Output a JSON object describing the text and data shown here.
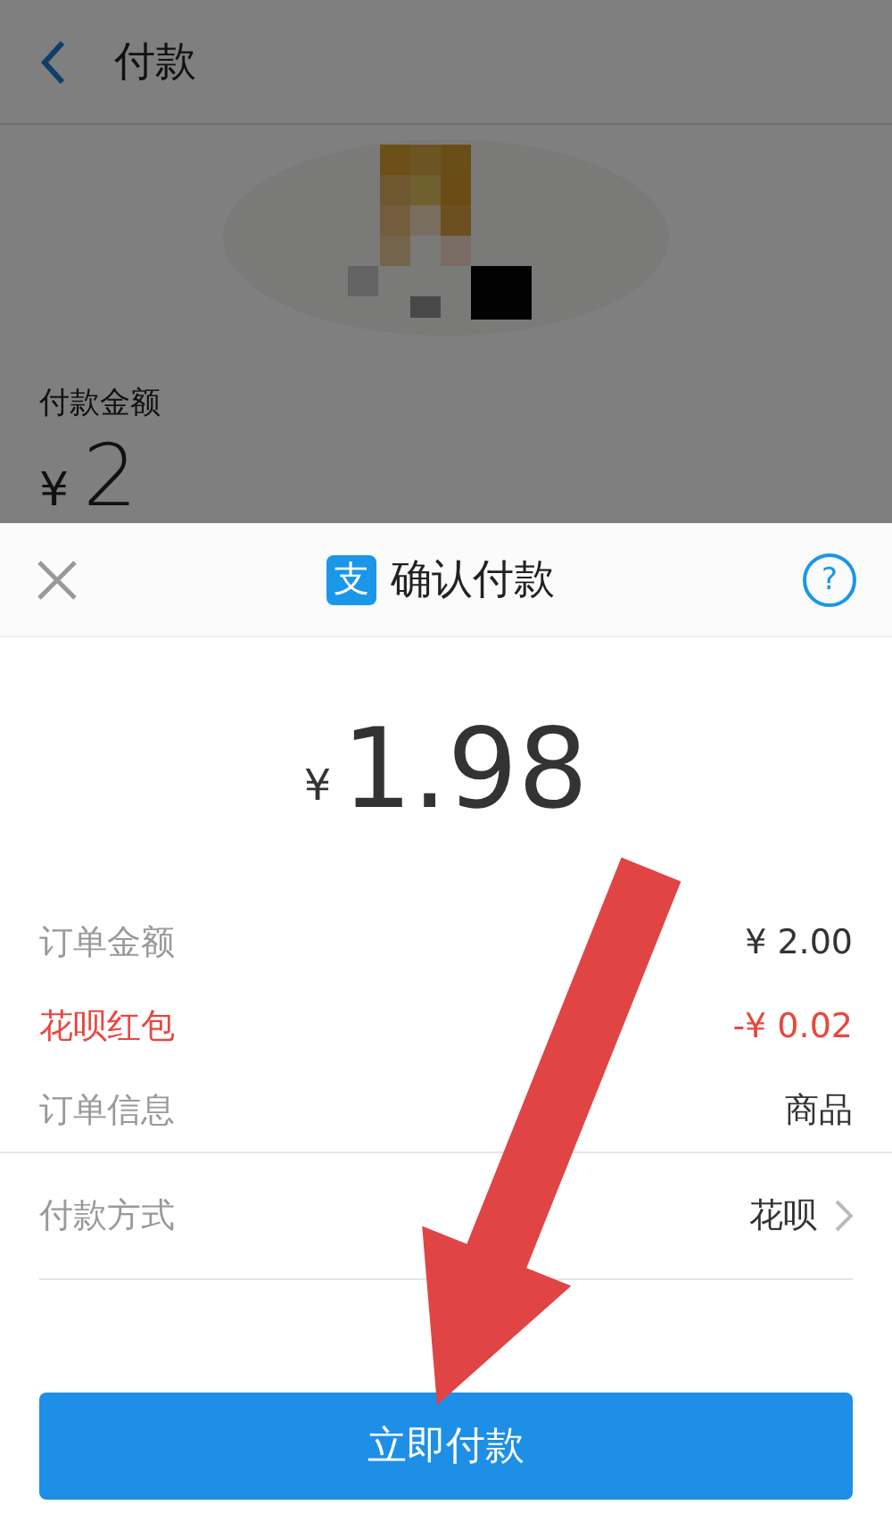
{
  "page": {
    "title": "付款",
    "amount_label": "付款金额",
    "currency": "¥",
    "amount": "2"
  },
  "sheet": {
    "logo": "支",
    "title": "确认付款",
    "help": "?",
    "currency": "¥",
    "total": "1.98",
    "rows": [
      {
        "label": "订单金额",
        "value": "¥ 2.00",
        "kind": "plain"
      },
      {
        "label": "花呗红包",
        "value": "-¥ 0.02",
        "kind": "discount"
      },
      {
        "label": "订单信息",
        "value": "商品",
        "kind": "plain"
      }
    ],
    "payment": {
      "label": "付款方式",
      "value": "花呗"
    },
    "button": "立即付款"
  }
}
